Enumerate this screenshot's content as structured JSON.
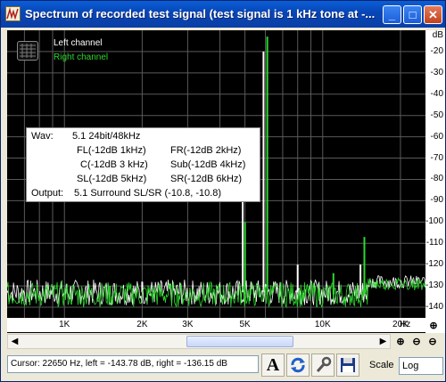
{
  "window": {
    "title": "Spectrum of recorded test signal (test signal is 1 kHz tone at -...",
    "minimize_label": "_",
    "maximize_label": "□",
    "close_label": "✕"
  },
  "legend": {
    "left_channel": "Left channel",
    "right_channel": "Right channel",
    "left_color": "#ffffff",
    "right_color": "#2dd82d"
  },
  "info": {
    "wav_label": "Wav:",
    "wav_value": "5.1 24bit/48kHz",
    "fl": "FL(-12dB  1kHz)",
    "fr": "FR(-12dB 2kHz)",
    "c": "C(-12dB 3 kHz)",
    "sub": "Sub(-12dB 4kHz)",
    "sl": "SL(-12dB 5kHz)",
    "sr": "SR(-12dB 6kHz)",
    "output_label": "Output:",
    "output_value": "5.1 Surround  SL/SR  (-10.8, -10.8)"
  },
  "chart_data": {
    "type": "line",
    "x_scale": "log",
    "x_ticks": [
      "1K",
      "2K",
      "3K",
      "5K",
      "10K",
      "20K"
    ],
    "x_unit": "Hz",
    "y_ticks": [
      "dB",
      "-20",
      "-30",
      "-40",
      "-50",
      "-60",
      "-70",
      "-80",
      "-90",
      "-100",
      "-110",
      "-120",
      "-130",
      "-140"
    ],
    "ylim": [
      -145,
      -10
    ],
    "grid": true,
    "legend_position": "top-left",
    "series": [
      {
        "name": "Left channel",
        "color": "#ffffff",
        "peaks": [
          {
            "x": 5900,
            "y": -20
          },
          {
            "x": 4900,
            "y": -86
          },
          {
            "x": 8000,
            "y": -120
          },
          {
            "x": 14000,
            "y": -120
          },
          {
            "x": 2000,
            "y": -128
          }
        ],
        "noise_floor": -133
      },
      {
        "name": "Right channel",
        "color": "#2dd82d",
        "peaks": [
          {
            "x": 6100,
            "y": -13
          },
          {
            "x": 5000,
            "y": -100
          },
          {
            "x": 14500,
            "y": -107
          },
          {
            "x": 11000,
            "y": -124
          },
          {
            "x": 1500,
            "y": -130
          }
        ],
        "noise_floor": -134
      }
    ]
  },
  "status": {
    "cursor_text": "Cursor:  22650 Hz,  left = -143.78 dB,  right = -136.15 dB"
  },
  "toolbar": {
    "font_icon": "A",
    "scale_label": "Scale",
    "scale_value": "Log"
  }
}
